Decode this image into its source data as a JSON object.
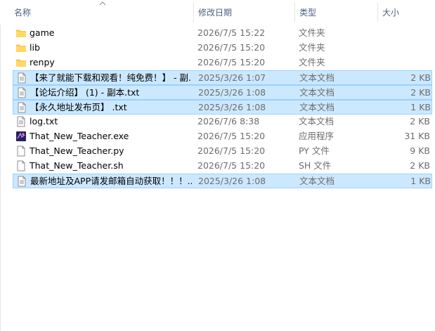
{
  "columns": {
    "name": "名称",
    "date": "修改日期",
    "type": "类型",
    "size": "大小"
  },
  "files": [
    {
      "name": "game",
      "date": "2026/7/5 15:22",
      "type": "文件夹",
      "size": "",
      "icon": "folder-icon",
      "selected": false
    },
    {
      "name": "lib",
      "date": "2026/7/5 15:20",
      "type": "文件夹",
      "size": "",
      "icon": "folder-icon",
      "selected": false
    },
    {
      "name": "renpy",
      "date": "2026/7/5 15:20",
      "type": "文件夹",
      "size": "",
      "icon": "folder-icon",
      "selected": false
    },
    {
      "name": "【来了就能下载和观看！纯免费！】 - 副...",
      "date": "2025/3/26 1:07",
      "type": "文本文档",
      "size": "2 KB",
      "icon": "text-file-icon",
      "selected": true
    },
    {
      "name": "【论坛介绍】 (1) - 副本.txt",
      "date": "2025/3/26 1:08",
      "type": "文本文档",
      "size": "2 KB",
      "icon": "text-file-icon",
      "selected": true
    },
    {
      "name": "【永久地址发布页】 .txt",
      "date": "2025/3/26 1:08",
      "type": "文本文档",
      "size": "1 KB",
      "icon": "text-file-icon",
      "selected": true
    },
    {
      "name": "log.txt",
      "date": "2026/7/6 8:38",
      "type": "文本文档",
      "size": "2 KB",
      "icon": "text-file-icon",
      "selected": false
    },
    {
      "name": "That_New_Teacher.exe",
      "date": "2026/7/5 15:20",
      "type": "应用程序",
      "size": "31 KB",
      "icon": "exe-icon",
      "selected": false
    },
    {
      "name": "That_New_Teacher.py",
      "date": "2026/7/5 15:20",
      "type": "PY 文件",
      "size": "9 KB",
      "icon": "blank-file-icon",
      "selected": false
    },
    {
      "name": "That_New_Teacher.sh",
      "date": "2026/7/5 15:20",
      "type": "SH 文件",
      "size": "2 KB",
      "icon": "blank-file-icon",
      "selected": false
    },
    {
      "name": "最新地址及APP请发邮箱自动获取！！！...",
      "date": "2025/3/26 1:08",
      "type": "文本文档",
      "size": "1 KB",
      "icon": "text-file-icon",
      "selected": true
    }
  ],
  "colors": {
    "selection": "#cce8ff",
    "selection_border": "#99d1ff",
    "folder": "#ffd766",
    "header_text": "#4d6082"
  }
}
